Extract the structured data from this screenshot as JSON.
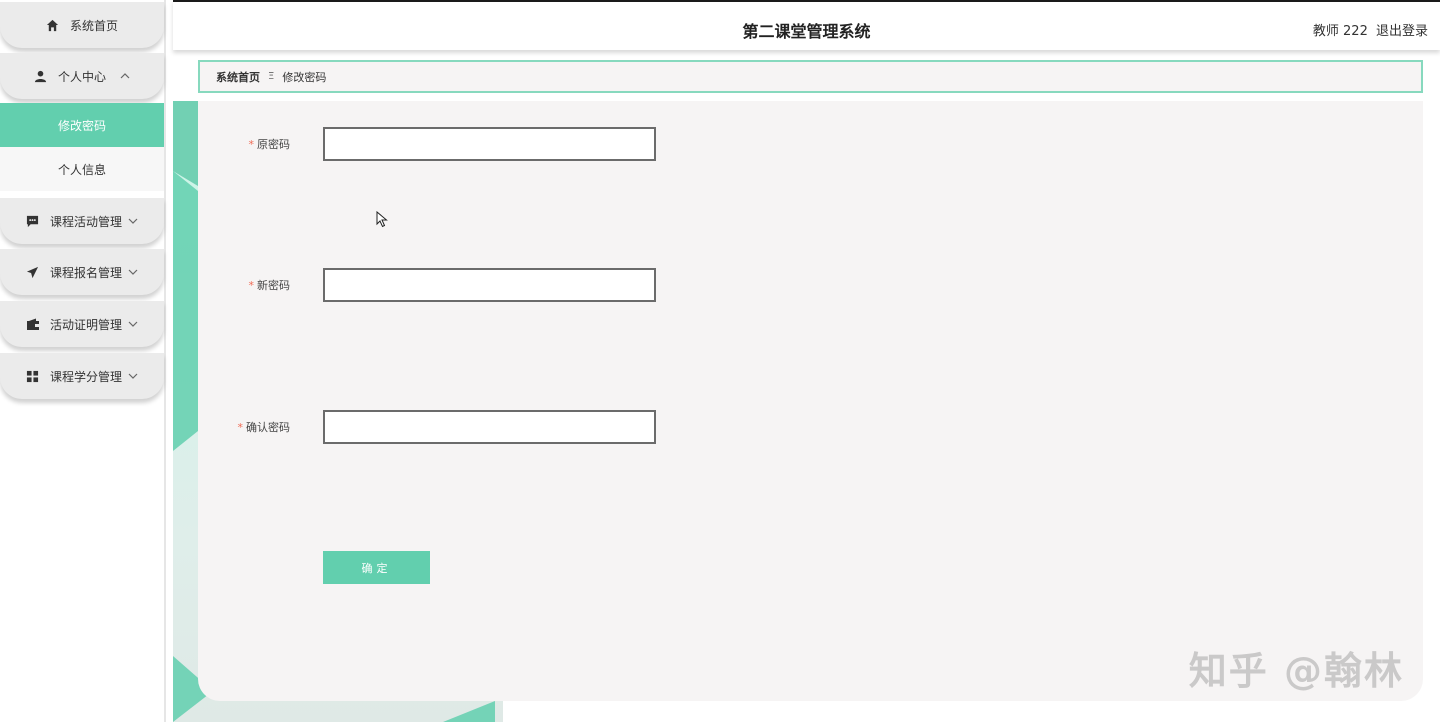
{
  "app": {
    "title": "第二课堂管理系统",
    "user_label": "教师 222",
    "logout_label": "退出登录"
  },
  "sidebar": {
    "items": [
      {
        "label": "系统首页",
        "icon": "home-icon"
      },
      {
        "label": "个人中心",
        "icon": "user-icon",
        "expanded": true,
        "children": [
          {
            "label": "修改密码",
            "active": true
          },
          {
            "label": "个人信息",
            "active": false
          }
        ]
      },
      {
        "label": "课程活动管理",
        "icon": "chat-icon"
      },
      {
        "label": "课程报名管理",
        "icon": "send-icon"
      },
      {
        "label": "活动证明管理",
        "icon": "wallet-icon"
      },
      {
        "label": "课程学分管理",
        "icon": "grid-icon"
      }
    ]
  },
  "breadcrumb": {
    "home": "系统首页",
    "separator": "Ξ",
    "current": "修改密码"
  },
  "form": {
    "required_mark": "*",
    "fields": [
      {
        "label": "原密码",
        "value": ""
      },
      {
        "label": "新密码",
        "value": ""
      },
      {
        "label": "确认密码",
        "value": ""
      }
    ],
    "submit_label": "确定"
  },
  "watermark": "知乎 @翰林",
  "colors": {
    "accent": "#62cfae",
    "border_accent": "#87d9be",
    "required": "#f06b55",
    "panel_bg": "#f6f4f4"
  }
}
